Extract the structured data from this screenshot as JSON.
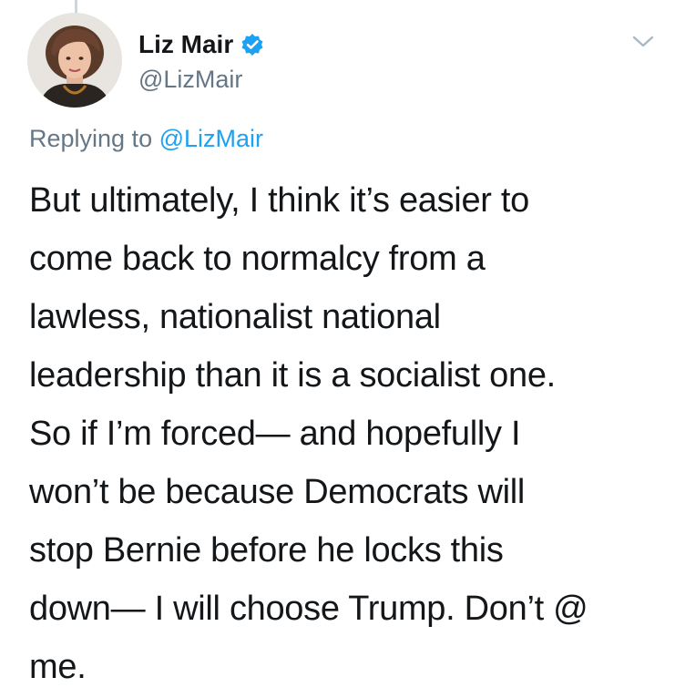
{
  "tweet": {
    "author": {
      "display_name": "Liz Mair",
      "handle": "@LizMair",
      "verified": true,
      "avatar_icon": "profile-photo"
    },
    "replying_prefix": "Replying to",
    "replying_to": "@LizMair",
    "text_lines": [
      "But ultimately, I think it’s easier to",
      "come back to normalcy from a",
      "lawless, nationalist national",
      "leadership than it is a socialist one.",
      "So if I’m forced— and hopefully I",
      "won’t be because Democrats will",
      "stop Bernie before he locks this",
      "down— I will choose Trump. Don’t @",
      "me."
    ]
  },
  "colors": {
    "link_blue": "#1da1f2",
    "secondary_gray": "#657786",
    "text_dark": "#14171a"
  }
}
